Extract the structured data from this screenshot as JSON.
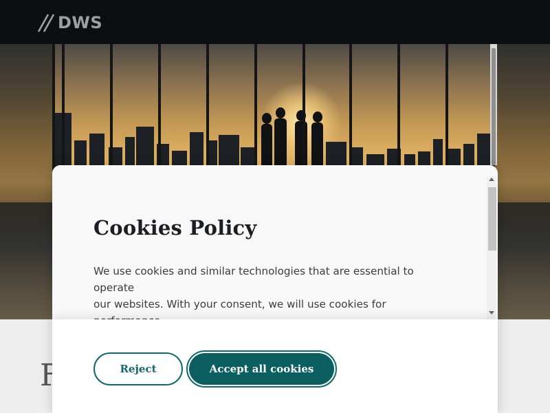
{
  "header": {
    "logo_text": "DWS",
    "logo_icon": "dws-slash-logo-icon",
    "background": "#0c0f11"
  },
  "page": {
    "heading_partial": "F"
  },
  "cookie_modal": {
    "title": "Cookies Policy",
    "body": "We use cookies and similar technologies that are essential to operate\nour websites.  With your consent, we will use cookies for performance\nanalysis of our websites. This enables us to detect and fix errors and\nusability issues as soon as possible and to monitor their resource",
    "reject_label": "Reject",
    "accept_label": "Accept all cookies",
    "accent_color": "#0b6a6a"
  }
}
